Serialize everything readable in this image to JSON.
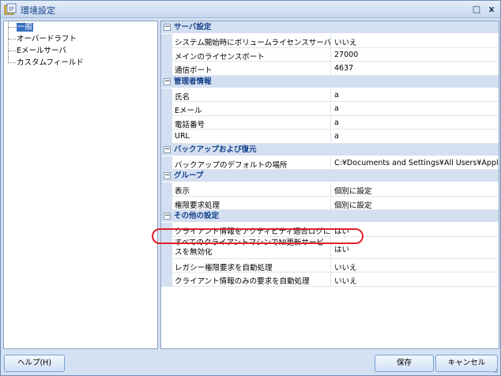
{
  "window": {
    "title": "環境設定",
    "minimize_label": "□",
    "close_label": "x"
  },
  "tree": {
    "items": [
      {
        "label": "一般",
        "selected": true
      },
      {
        "label": "オーバードラフト",
        "selected": false
      },
      {
        "label": "Eメールサーバ",
        "selected": false
      },
      {
        "label": "カスタムフィールド",
        "selected": false
      }
    ]
  },
  "grid": {
    "categories": [
      {
        "label": "サーバ設定",
        "toggle": "⊟",
        "rows": [
          {
            "name": "システム開始時にボリュームライセンスサーバを起動",
            "value": "いいえ"
          },
          {
            "name": "メインのライセンスポート",
            "value": "27000"
          },
          {
            "name": "通信ポート",
            "value": "4637"
          }
        ]
      },
      {
        "label": "管理者情報",
        "toggle": "⊟",
        "rows": [
          {
            "name": "氏名",
            "value": "a"
          },
          {
            "name": "Eメール",
            "value": "a"
          },
          {
            "name": "電話番号",
            "value": "a"
          },
          {
            "name": "URL",
            "value": "a"
          }
        ]
      },
      {
        "label": "バックアップおよび復元",
        "toggle": "⊟",
        "rows": [
          {
            "name": "バックアップのデフォルトの場所",
            "value": "C:¥Documents and Settings¥All Users¥Applica..."
          }
        ]
      },
      {
        "label": "グループ",
        "toggle": "⊟",
        "rows": [
          {
            "name": "表示",
            "value": "個別に設定"
          },
          {
            "name": "権限要求処理",
            "value": "個別に設定"
          }
        ]
      },
      {
        "label": "その他の設定",
        "toggle": "⊟",
        "rows": [
          {
            "name": "クライアント情報をアクティビティ適合ログに含める",
            "value": "はい"
          },
          {
            "name": "すべてのクライアントマシンでNI更新サービスを無効化",
            "value": "はい"
          },
          {
            "name": "レガシー権限要求を自動処理",
            "value": "いいえ"
          },
          {
            "name": "クライアント情報のみの要求を自動処理",
            "value": "いいえ"
          }
        ]
      }
    ]
  },
  "buttons": {
    "help": "ヘルプ(H)",
    "save": "保存",
    "cancel": "キャンセル"
  },
  "colors": {
    "accent": "#15428b",
    "selection": "#3a6fc4",
    "highlight_ring": "#e0202a"
  }
}
